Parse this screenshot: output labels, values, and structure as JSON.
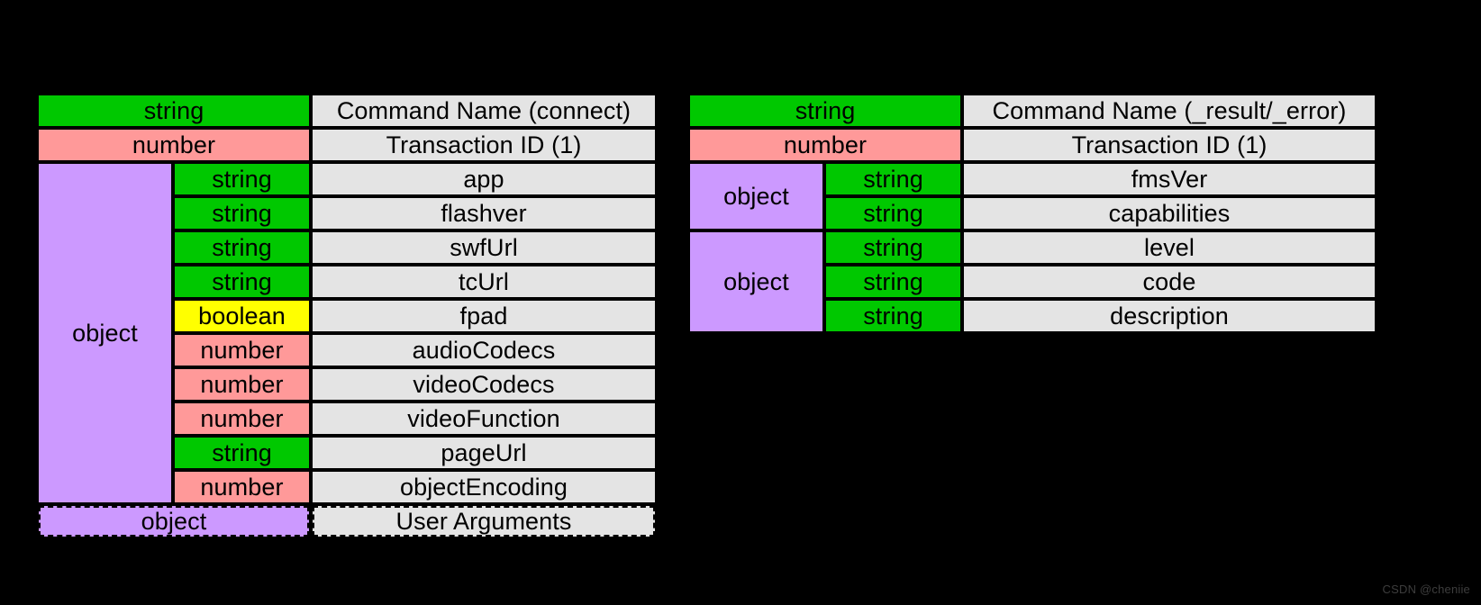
{
  "background_color": "#000000",
  "palette": {
    "string": "#00c800",
    "number": "#ff9999",
    "boolean": "#ffff00",
    "object": "#cc99ff",
    "description": "#e4e4e4",
    "text": "#000000",
    "watermark": "#3d3d3d"
  },
  "diagrams": [
    {
      "id": "connect",
      "header_rows": [
        {
          "type": "string",
          "description": "Command Name (connect)"
        },
        {
          "type": "number",
          "description": "Transaction ID (1)"
        }
      ],
      "groups": [
        {
          "group_type": "object",
          "optional": false,
          "rows": [
            {
              "type": "string",
              "description": "app"
            },
            {
              "type": "string",
              "description": "flashver"
            },
            {
              "type": "string",
              "description": "swfUrl"
            },
            {
              "type": "string",
              "description": "tcUrl"
            },
            {
              "type": "boolean",
              "description": "fpad"
            },
            {
              "type": "number",
              "description": "audioCodecs"
            },
            {
              "type": "number",
              "description": "videoCodecs"
            },
            {
              "type": "number",
              "description": "videoFunction"
            },
            {
              "type": "string",
              "description": "pageUrl"
            },
            {
              "type": "number",
              "description": "objectEncoding"
            }
          ]
        }
      ],
      "optional_row": {
        "type": "object",
        "description": "User Arguments"
      }
    },
    {
      "id": "result",
      "header_rows": [
        {
          "type": "string",
          "description": "Command Name (_result/_error)"
        },
        {
          "type": "number",
          "description": "Transaction ID (1)"
        }
      ],
      "groups": [
        {
          "group_type": "object",
          "optional": false,
          "rows": [
            {
              "type": "string",
              "description": "fmsVer"
            },
            {
              "type": "string",
              "description": "capabilities"
            }
          ]
        },
        {
          "group_type": "object",
          "optional": false,
          "rows": [
            {
              "type": "string",
              "description": "level"
            },
            {
              "type": "string",
              "description": "code"
            },
            {
              "type": "string",
              "description": "description"
            }
          ]
        }
      ],
      "optional_row": null
    }
  ],
  "watermark": "CSDN @cheniie"
}
